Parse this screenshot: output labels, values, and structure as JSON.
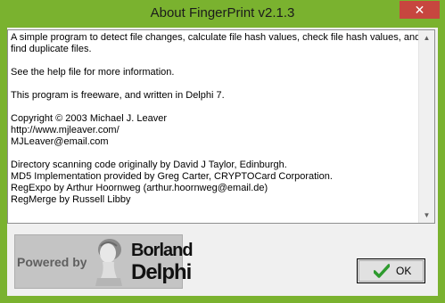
{
  "window": {
    "title": "About FingerPrint v2.1.3",
    "close_glyph": "✕"
  },
  "about_text": [
    "A simple program to detect file changes, calculate file hash values, check file hash values, and",
    "find duplicate files.",
    "",
    "See the help file for more information.",
    "",
    "This program is freeware, and written in Delphi 7.",
    "",
    "Copyright © 2003 Michael J. Leaver",
    "http://www.mjleaver.com/",
    "MJLeaver@email.com",
    "",
    "Directory scanning code originally by David J Taylor, Edinburgh.",
    "MD5 Implementation provided by Greg Carter, CRYPTOCard Corporation.",
    "RegExpo by Arthur Hoornweg (arthur.hoornweg@email.de)",
    "RegMerge by Russell Libby"
  ],
  "logo": {
    "powered_by": "Powered by",
    "borland": "Borland",
    "delphi": "Delphi"
  },
  "ok_button": {
    "label": "OK"
  },
  "colors": {
    "title_bar": "#7ab22f",
    "close_button": "#c7463f",
    "check_icon": "#2e9b2e"
  }
}
